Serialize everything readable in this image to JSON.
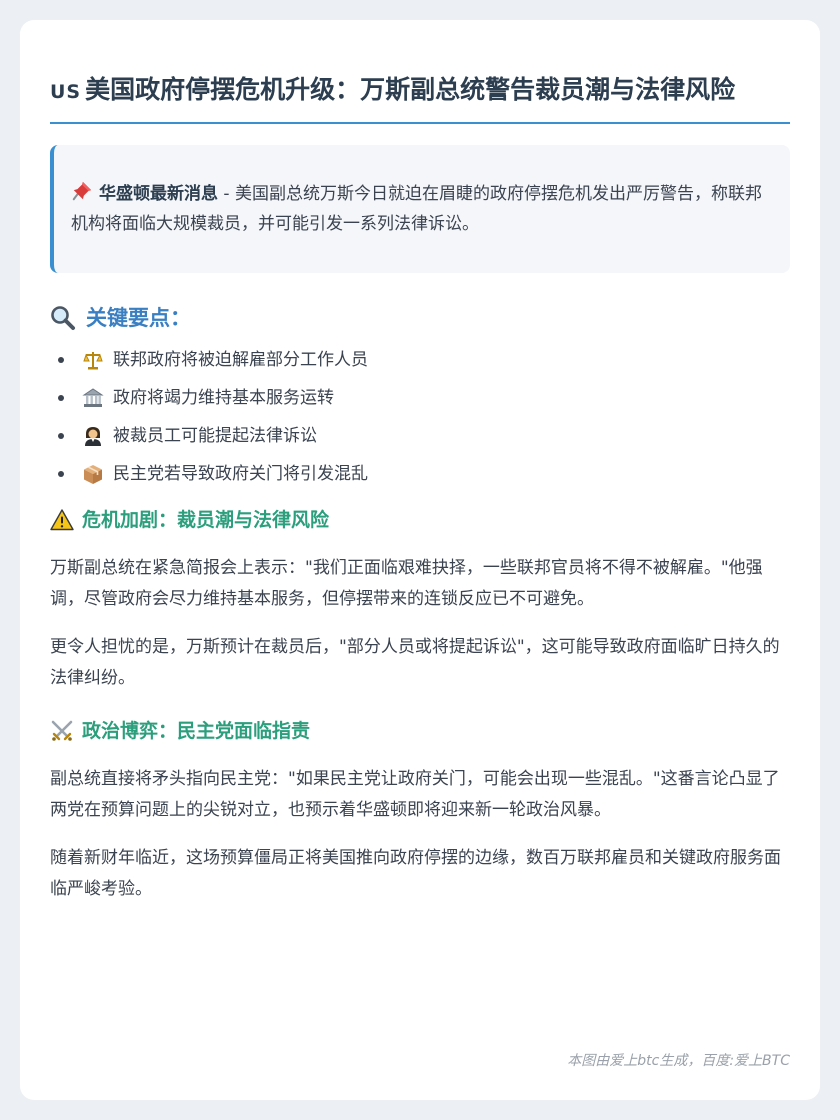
{
  "article": {
    "flag": "US",
    "title": "美国政府停摆危机升级：万斯副总统警告裁员潮与法律风险",
    "callout": {
      "icon": "pushpin-icon",
      "lead": "华盛顿最新消息",
      "text": " - 美国副总统万斯今日就迫在眉睫的政府停摆危机发出严厉警告，称联邦机构将面临大规模裁员，并可能引发一系列法律诉讼。"
    },
    "key_points": {
      "icon": "magnifier-icon",
      "heading": "关键要点：",
      "items": [
        {
          "icon": "scales-icon",
          "text": "联邦政府将被迫解雇部分工作人员"
        },
        {
          "icon": "government-building-icon",
          "text": "政府将竭力维持基本服务运转"
        },
        {
          "icon": "judge-icon",
          "text": "被裁员工可能提起法律诉讼"
        },
        {
          "icon": "package-icon",
          "text": "民主党若导致政府关门将引发混乱"
        }
      ]
    },
    "section1": {
      "icon": "warning-icon",
      "heading": "危机加剧：裁员潮与法律风险",
      "p1": "万斯副总统在紧急简报会上表示：\"我们正面临艰难抉择，一些联邦官员将不得不被解雇。\"他强调，尽管政府会尽力维持基本服务，但停摆带来的连锁反应已不可避免。",
      "p2": "更令人担忧的是，万斯预计在裁员后，\"部分人员或将提起诉讼\"，这可能导致政府面临旷日持久的法律纠纷。"
    },
    "section2": {
      "icon": "crossed-swords-icon",
      "heading": "政治博弈：民主党面临指责",
      "p1": "副总统直接将矛头指向民主党：\"如果民主党让政府关门，可能会出现一些混乱。\"这番言论凸显了两党在预算问题上的尖锐对立，也预示着华盛顿即将迎来新一轮政治风暴。",
      "p2": "随着新财年临近，这场预算僵局正将美国推向政府停摆的边缘，数百万联邦雇员和关键政府服务面临严峻考验。"
    },
    "footer": "本图由爱上btc生成，百度:爱上BTC"
  },
  "colors": {
    "accent_blue": "#3a8fd1",
    "heading_green": "#2b9e7c",
    "text": "#3b4350"
  }
}
